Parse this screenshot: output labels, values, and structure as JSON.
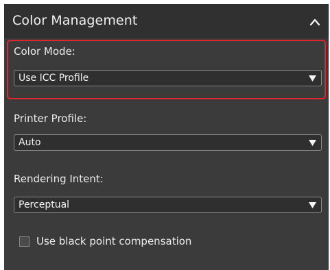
{
  "section": {
    "title": "Color Management",
    "collapse_icon": "chevron-up-icon"
  },
  "color_mode": {
    "label": "Color Mode:",
    "value": "Use ICC Profile",
    "highlight_color": "#e3262e"
  },
  "printer_profile": {
    "label": "Printer Profile:",
    "value": "Auto"
  },
  "rendering_intent": {
    "label": "Rendering Intent:",
    "value": "Perceptual"
  },
  "black_point": {
    "label": "Use black point compensation",
    "checked": false
  },
  "colors": {
    "panel_bg": "#3b3b3b",
    "header_bg": "#303030",
    "field_bg": "#2f2f2f",
    "text": "#ececec"
  }
}
